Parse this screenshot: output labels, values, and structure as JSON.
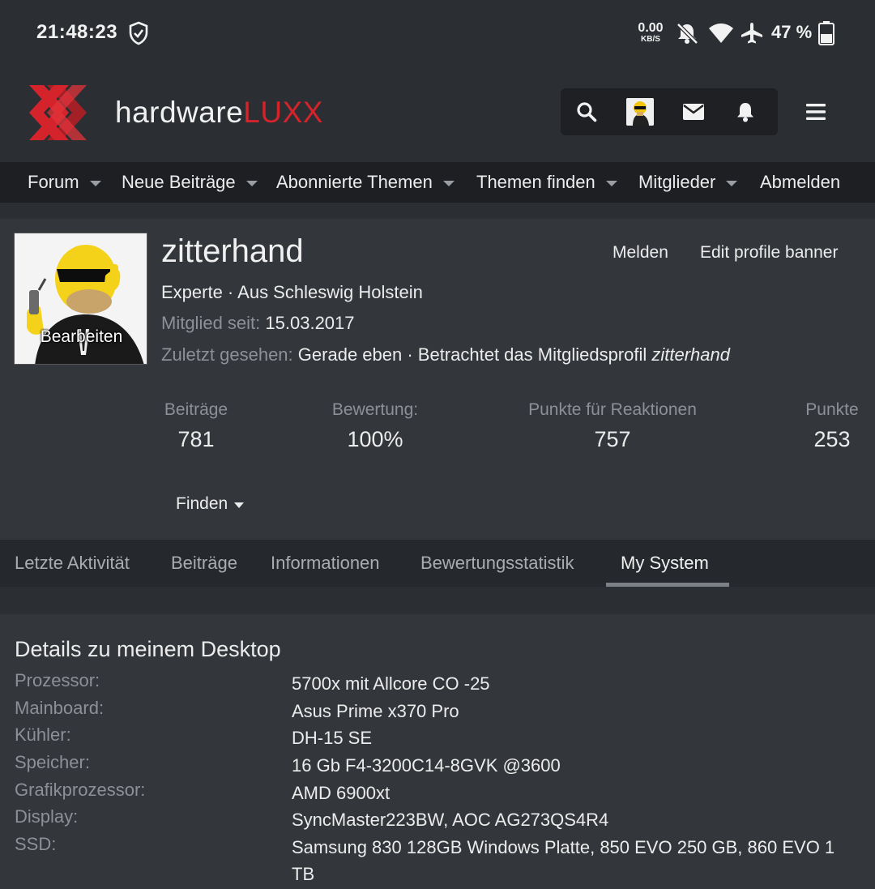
{
  "status_bar": {
    "time": "21:48:23",
    "net_speed_value": "0.00",
    "net_speed_unit": "KB/S",
    "battery_percent": "47 %",
    "icons": [
      "shield-check-icon",
      "bell-off-icon",
      "wifi-icon",
      "airplane-icon",
      "battery-icon"
    ]
  },
  "header": {
    "logo_text_main": "hardware",
    "logo_text_accent": "LUXX",
    "brand_color": "#d5232b",
    "toolbar_icons": [
      "search-icon",
      "user-avatar",
      "mail-icon",
      "bell-icon"
    ],
    "menu_icon": "hamburger-icon"
  },
  "nav": {
    "items": [
      {
        "label": "Forum",
        "has_dropdown": true
      },
      {
        "label": "Neue Beiträge",
        "has_dropdown": true
      },
      {
        "label": "Abonnierte Themen",
        "has_dropdown": true
      },
      {
        "label": "Themen finden",
        "has_dropdown": true
      },
      {
        "label": "Mitglieder",
        "has_dropdown": true
      },
      {
        "label": "Abmelden",
        "has_dropdown": false
      }
    ]
  },
  "profile": {
    "avatar_edit_label": "Bearbeiten",
    "username": "zitterhand",
    "actions": {
      "report": "Melden",
      "edit_banner": "Edit profile banner"
    },
    "title_line": "Experte · Aus Schleswig Holstein",
    "member_since_label": "Mitglied seit:",
    "member_since_value": "15.03.2017",
    "last_seen_label": "Zuletzt gesehen:",
    "last_seen_value": "Gerade eben · Betrachtet das Mitgliedsprofil",
    "last_seen_profile": "zitterhand",
    "stats": [
      {
        "label": "Beiträge",
        "value": "781"
      },
      {
        "label": "Bewertung:",
        "value": "100%"
      },
      {
        "label": "Punkte für Reaktionen",
        "value": "757"
      },
      {
        "label": "Punkte",
        "value": "253"
      }
    ],
    "find_label": "Finden"
  },
  "tabs": {
    "items": [
      "Letzte Aktivität",
      "Beiträge",
      "Informationen",
      "Bewertungsstatistik",
      "My System"
    ],
    "active": "My System"
  },
  "system": {
    "title": "Details zu meinem Desktop",
    "rows": [
      {
        "key": "Prozessor:",
        "value": "5700x mit Allcore CO -25"
      },
      {
        "key": "Mainboard:",
        "value": "Asus Prime x370 Pro"
      },
      {
        "key": "Kühler:",
        "value": "DH-15 SE"
      },
      {
        "key": "Speicher:",
        "value": "16 Gb F4-3200C14-8GVK @3600"
      },
      {
        "key": "Grafikprozessor:",
        "value": "AMD 6900xt"
      },
      {
        "key": "Display:",
        "value": "SyncMaster223BW, AOC AG273QS4R4"
      },
      {
        "key": "SSD:",
        "value": "Samsung 830 128GB Windows Platte, 850 EVO 250 GB, 860 EVO 1 TB"
      }
    ]
  }
}
